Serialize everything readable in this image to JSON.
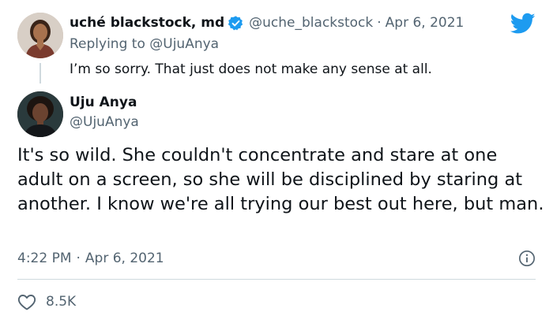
{
  "reply_tweet": {
    "author_name": "uché blackstock, md",
    "handle": "@uche_blackstock",
    "separator": "·",
    "date": "Apr 6, 2021",
    "replying_to_label": "Replying to",
    "replying_to_handle": "@UjuAnya",
    "text": "I’m so sorry. That just does not make any sense at all."
  },
  "main_tweet": {
    "author_name": "Uju Anya",
    "handle": "@UjuAnya",
    "text": "It's so wild. She couldn't concentrate and stare at one adult on a screen, so she will be disciplined by staring at another. I know we're all trying our best out here, but man.",
    "time": "4:22 PM",
    "separator": "·",
    "date": "Apr 6, 2021",
    "likes": "8.5K"
  },
  "icons": {
    "verified": "verified-badge-icon",
    "logo": "twitter-bird-icon",
    "info": "info-icon",
    "like": "heart-icon"
  },
  "colors": {
    "brand_blue": "#1d9bf0",
    "text_primary": "#0f1419",
    "text_secondary": "#536471",
    "divider": "#cfd9de"
  }
}
